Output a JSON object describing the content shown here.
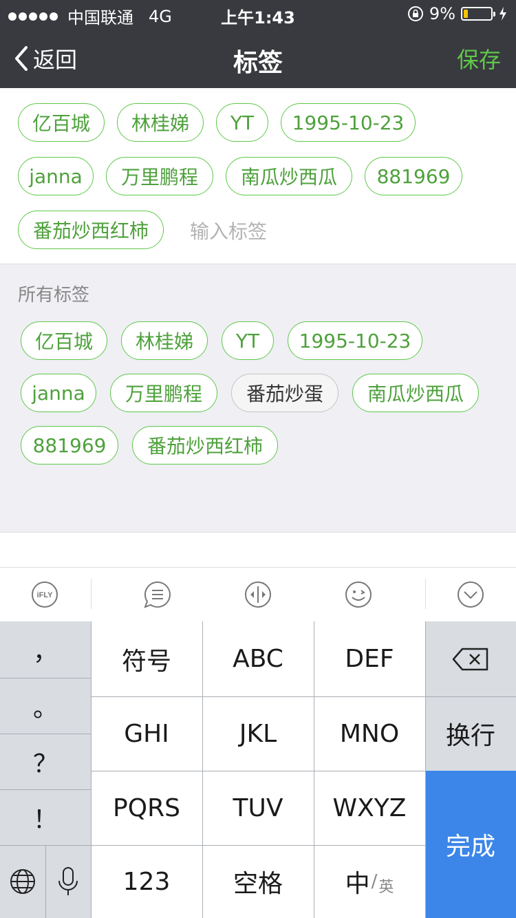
{
  "status_bar": {
    "carrier": "中国联通",
    "network": "4G",
    "time": "上午1:43",
    "battery_percent": "9%",
    "battery_level": 0.09
  },
  "nav": {
    "back_label": "返回",
    "title": "标签",
    "save_label": "保存",
    "accent_color": "#5fc84a"
  },
  "selected_tags": [
    "亿百城",
    "林桂娣",
    "YT",
    "1995-10-23",
    "janna",
    "万里鹏程",
    "南瓜炒西瓜",
    "881969",
    "番茄炒西红柿"
  ],
  "input": {
    "placeholder": "输入标签"
  },
  "all_tags": {
    "title": "所有标签",
    "items": [
      "亿百城",
      "林桂娣",
      "YT",
      "1995-10-23",
      "janna",
      "万里鹏程",
      "番茄炒蛋",
      "南瓜炒西瓜",
      "881969",
      "番茄炒西红柿"
    ]
  },
  "keyboard": {
    "toolbar_icons": [
      "ifly-icon",
      "menu-icon",
      "cursor-icon",
      "emoji-icon",
      "collapse-icon"
    ],
    "ifly_label": "iFLY",
    "punctuation": [
      "，",
      "。",
      "？",
      "！"
    ],
    "keys": {
      "symbols": "符号",
      "abc": "ABC",
      "def": "DEF",
      "ghi": "GHI",
      "jkl": "JKL",
      "mno": "MNO",
      "pqrs": "PQRS",
      "tuv": "TUV",
      "wxyz": "WXYZ",
      "newline": "换行",
      "done": "完成",
      "num": "123",
      "space": "空格",
      "lang_main": "中",
      "lang_sub": "英"
    },
    "done_color": "#3b86e8"
  }
}
